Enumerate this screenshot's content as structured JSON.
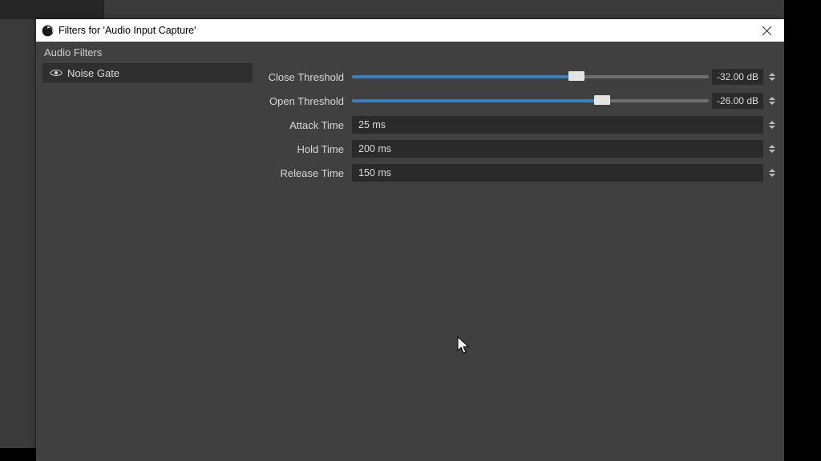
{
  "window": {
    "title": "Filters for 'Audio Input Capture'"
  },
  "section": {
    "header": "Audio Filters"
  },
  "filters": [
    {
      "label": "Noise Gate",
      "visible": true
    }
  ],
  "params": {
    "close_threshold": {
      "label": "Close Threshold",
      "value_text": "-32.00 dB",
      "fill_pct": 63
    },
    "open_threshold": {
      "label": "Open Threshold",
      "value_text": "-26.00 dB",
      "fill_pct": 70
    },
    "attack_time": {
      "label": "Attack Time",
      "value_text": "25 ms"
    },
    "hold_time": {
      "label": "Hold Time",
      "value_text": "200 ms"
    },
    "release_time": {
      "label": "Release Time",
      "value_text": "150 ms"
    }
  },
  "colors": {
    "slider_fill": "#3a7fbf",
    "panel_bg": "#404040",
    "input_bg": "#2a2a2a"
  }
}
